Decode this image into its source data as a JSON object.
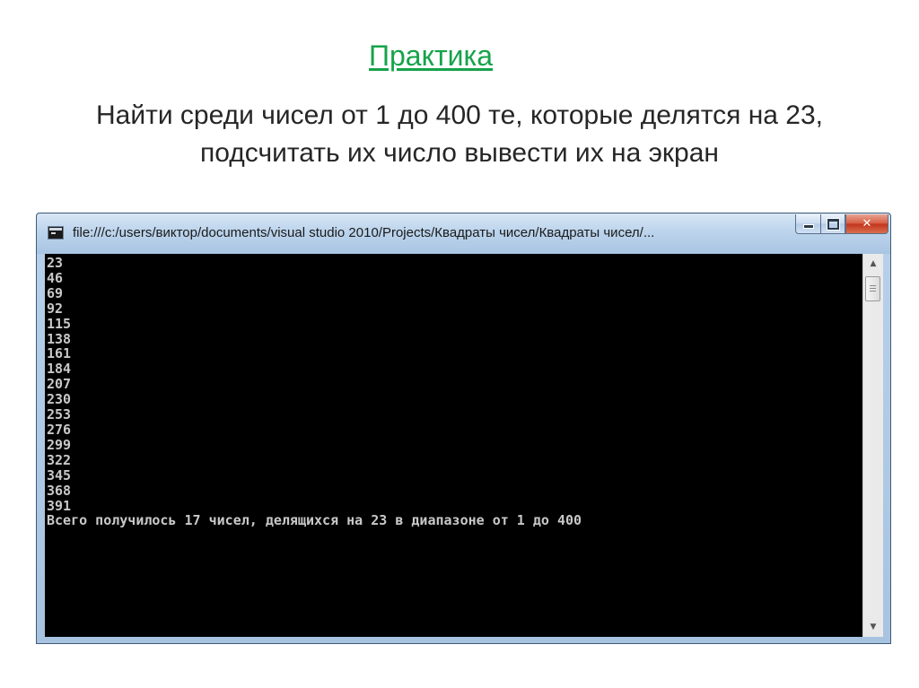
{
  "slide": {
    "title": "Практика",
    "task_line1": "Найти среди чисел от 1 до 400 те, которые делятся на 23,",
    "task_line2": "подсчитать их число вывести их на экран"
  },
  "window": {
    "title": "file:///c:/users/виктор/documents/visual studio 2010/Projects/Квадраты чисел/Квадраты чисел/...",
    "controls": {
      "minimize": "minimize-icon",
      "maximize": "maximize-icon",
      "close": "✕"
    }
  },
  "console": {
    "output": "23\n46\n69\n92\n115\n138\n161\n184\n207\n230\n253\n276\n299\n322\n345\n368\n391\nВсего получилось 17 чисел, делящихся на 23 в диапазоне от 1 до 400"
  },
  "scrollbar": {
    "up_glyph": "▲",
    "down_glyph": "▼",
    "position": 0.0
  },
  "colors": {
    "title_accent": "#16a34a",
    "console_background": "#000000",
    "console_text": "#c8c8c8",
    "close_button": "#c2331b"
  }
}
